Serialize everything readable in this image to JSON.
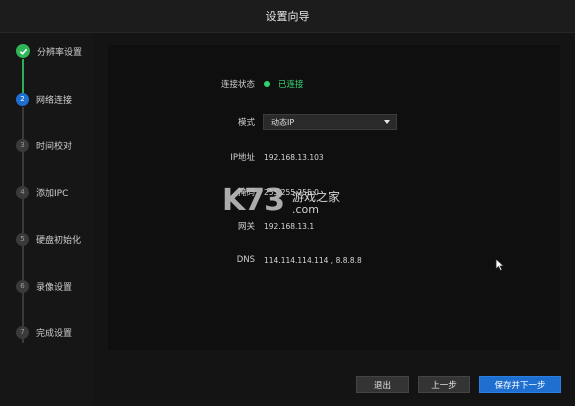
{
  "window": {
    "title": "设置向导"
  },
  "steps": [
    {
      "num": "",
      "label": "分辨率设置",
      "state": "done"
    },
    {
      "num": "2",
      "label": "网络连接",
      "state": "current"
    },
    {
      "num": "3",
      "label": "时间校对",
      "state": "pending"
    },
    {
      "num": "4",
      "label": "添加IPC",
      "state": "pending"
    },
    {
      "num": "5",
      "label": "硬盘初始化",
      "state": "pending"
    },
    {
      "num": "6",
      "label": "录像设置",
      "state": "pending"
    },
    {
      "num": "7",
      "label": "完成设置",
      "state": "pending"
    }
  ],
  "network": {
    "status_label": "连接状态",
    "status_value": "已连接",
    "mode_label": "模式",
    "mode_value": "动态IP",
    "ip_label": "IP地址",
    "ip_value": "192.168.13.103",
    "mask_label": "掩码",
    "mask_value": "255.255.255.0",
    "gateway_label": "网关",
    "gateway_value": "192.168.13.1",
    "dns_label": "DNS",
    "dns_value": "114.114.114.114 , 8.8.8.8"
  },
  "buttons": {
    "exit": "退出",
    "prev": "上一步",
    "save_next": "保存并下一步"
  },
  "watermark": {
    "brand": "K73",
    "text": "游戏之家",
    "domain": ".com"
  },
  "colors": {
    "accent_blue": "#1f6fd1",
    "done_green": "#2fb457",
    "status_green": "#3bd774"
  },
  "icons": {
    "done": "check-icon",
    "status": "status-dot-icon",
    "dropdown": "chevron-down-icon",
    "cursor": "mouse-pointer-icon"
  }
}
